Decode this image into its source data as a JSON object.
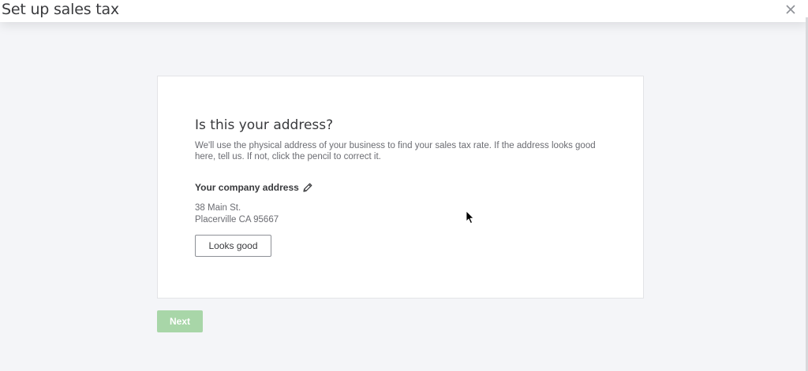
{
  "header": {
    "title": "Set up sales tax",
    "close_icon": "close-icon"
  },
  "card": {
    "heading": "Is this your address?",
    "description": "We'll use the physical address of your business to find your sales tax rate. If the address looks good here, tell us. If not, click the pencil to correct it.",
    "address_label": "Your company address",
    "edit_icon": "pencil-icon",
    "address_line1": "38 Main St.",
    "address_line2": "Placerville CA 95667",
    "looks_good_label": "Looks good"
  },
  "footer": {
    "next_label": "Next",
    "next_disabled": true
  },
  "colors": {
    "text": "#393a3d",
    "muted": "#6b6c72",
    "next_disabled": "#a8d6a8",
    "background": "#f4f5f8"
  }
}
